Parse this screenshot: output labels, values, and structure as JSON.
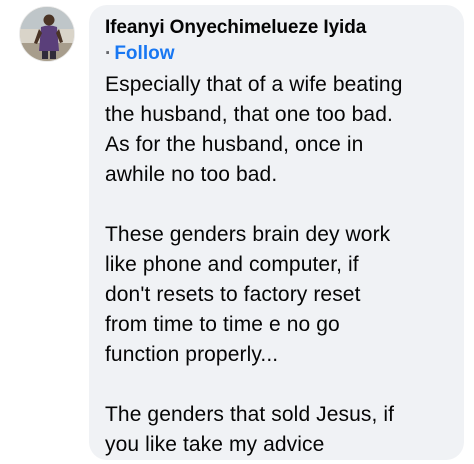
{
  "comment": {
    "author": "Ifeanyi Onyechimelueze Iyida",
    "separator": "·",
    "follow_label": "Follow",
    "avatar_icon": "profile-photo-avatar",
    "paragraphs": [
      {
        "lines": [
          "Especially that of a wife beating",
          "the husband, that one too bad.",
          "As for the husband, once in",
          "awhile no too bad."
        ]
      },
      {
        "lines": [
          "These genders brain dey work",
          "like phone and computer, if",
          "don't resets to factory reset",
          "from time to time e no go",
          "function properly..."
        ]
      },
      {
        "lines": [
          "The genders that sold Jesus, if",
          "you like take my advice"
        ]
      }
    ]
  },
  "colors": {
    "bubble_bg": "#f0f2f5",
    "follow_link": "#1877f2",
    "text": "#050505",
    "muted": "#65676b"
  }
}
